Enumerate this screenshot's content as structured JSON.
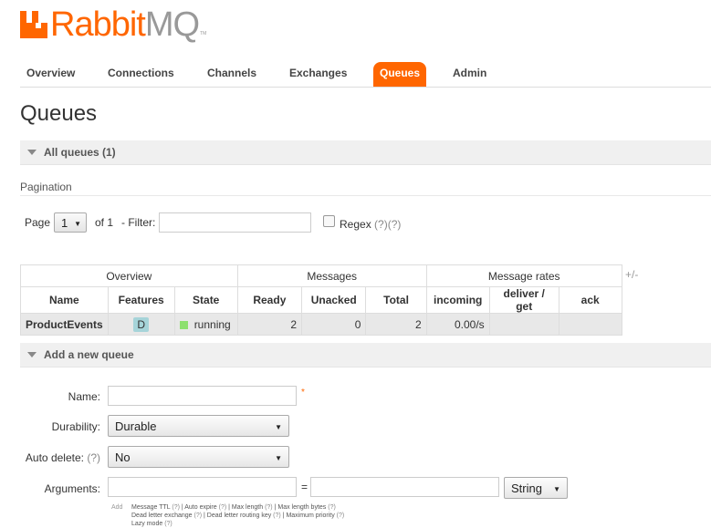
{
  "brand": {
    "rabbit": "Rabbit",
    "mq": "MQ",
    "tm": "TM"
  },
  "nav": {
    "overview": "Overview",
    "connections": "Connections",
    "channels": "Channels",
    "exchanges": "Exchanges",
    "queues": "Queues",
    "admin": "Admin"
  },
  "page_title": "Queues",
  "all_queues": {
    "header": "All queues (1)",
    "pagination_label": "Pagination",
    "page_label": "Page",
    "page_value": "1",
    "of_label": "of 1",
    "filter_label": "- Filter:",
    "filter_value": "",
    "regex_label": "Regex",
    "regex_hint": "(?)(?)",
    "plus_minus": "+/-",
    "groups": {
      "overview": "Overview",
      "messages": "Messages",
      "rates": "Message rates"
    },
    "columns": {
      "name": "Name",
      "features": "Features",
      "state": "State",
      "ready": "Ready",
      "unacked": "Unacked",
      "total": "Total",
      "incoming": "incoming",
      "deliver_get": "deliver / get",
      "ack": "ack"
    },
    "rows": [
      {
        "name": "ProductEvents",
        "feature": "D",
        "state": "running",
        "ready": "2",
        "unacked": "0",
        "total": "2",
        "incoming": "0.00/s",
        "deliver_get": "",
        "ack": ""
      }
    ]
  },
  "add_queue": {
    "header": "Add a new queue",
    "name_label": "Name:",
    "name_value": "",
    "required_mark": "*",
    "durability_label": "Durability:",
    "durability_value": "Durable",
    "auto_delete_label": "Auto delete:",
    "auto_delete_hint": "(?)",
    "auto_delete_value": "No",
    "arguments_label": "Arguments:",
    "equals": "=",
    "arg_type_value": "String",
    "add_label": "Add",
    "arg_hints_line1": [
      {
        "text": "Message TTL",
        "q": "(?)"
      },
      {
        "text": "Auto expire",
        "q": "(?)"
      },
      {
        "text": "Max length",
        "q": "(?)"
      },
      {
        "text": "Max length bytes",
        "q": "(?)"
      }
    ],
    "arg_hints_line2": [
      {
        "text": "Dead letter exchange",
        "q": "(?)"
      },
      {
        "text": "Dead letter routing key",
        "q": "(?)"
      },
      {
        "text": "Maximum priority",
        "q": "(?)"
      }
    ],
    "arg_hints_line3": [
      {
        "text": "Lazy mode",
        "q": "(?)"
      }
    ],
    "separator": "|"
  },
  "colors": {
    "brand_orange": "#ff6600",
    "brand_gray": "#999999",
    "running": "#8de06f",
    "durable_badge": "#a6d4d9"
  }
}
